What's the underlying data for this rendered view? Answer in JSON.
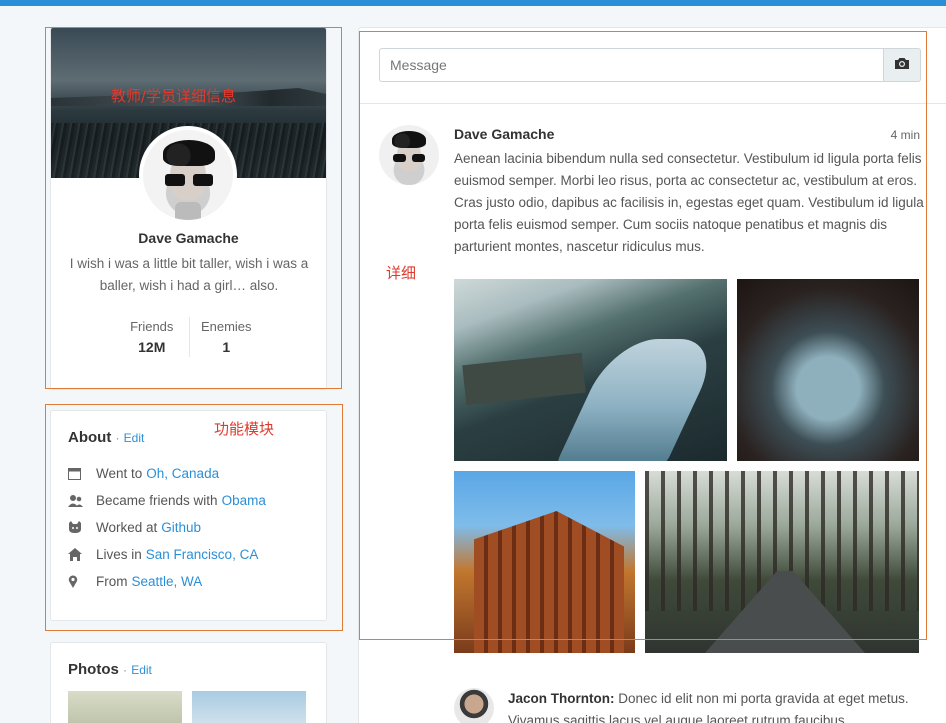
{
  "profile": {
    "name": "Dave Gamache",
    "bio": "I wish i was a little bit taller, wish i was a baller, wish i had a girl… also.",
    "stats": [
      {
        "label": "Friends",
        "value": "12M"
      },
      {
        "label": "Enemies",
        "value": "1"
      }
    ]
  },
  "about": {
    "title": "About",
    "edit": "Edit",
    "items": [
      {
        "icon": "calendar-icon",
        "text": "Went to",
        "link": "Oh, Canada"
      },
      {
        "icon": "users-icon",
        "text": "Became friends with",
        "link": "Obama"
      },
      {
        "icon": "github-icon",
        "text": "Worked at",
        "link": "Github"
      },
      {
        "icon": "home-icon",
        "text": "Lives in",
        "link": "San Francisco, CA"
      },
      {
        "icon": "location-pin-icon",
        "text": "From",
        "link": "Seattle, WA"
      }
    ]
  },
  "photos": {
    "title": "Photos",
    "edit": "Edit"
  },
  "feed": {
    "message_placeholder": "Message",
    "post": {
      "author": "Dave Gamache",
      "time": "4 min",
      "text": "Aenean lacinia bibendum nulla sed consectetur. Vestibulum id ligula porta felis euismod semper. Morbi leo risus, porta ac consectetur ac, vestibulum at eros. Cras justo odio, dapibus ac facilisis in, egestas eget quam. Vestibulum id ligula porta felis euismod semper. Cum sociis natoque penatibus et magnis dis parturient montes, nascetur ridiculus mus."
    },
    "comment": {
      "author": "Jacon Thornton:",
      "text": "Donec id elit non mi porta gravida at eget metus. Vivamus sagittis lacus vel augue laoreet rutrum faucibus"
    }
  },
  "annotations": {
    "profile": "教师/学员详细信息",
    "modules": "功能模块",
    "detail": "详细"
  },
  "colors": {
    "accent": "#2b8fd8",
    "annotation": "#e07b39",
    "annotation_text": "#e03a2e"
  }
}
